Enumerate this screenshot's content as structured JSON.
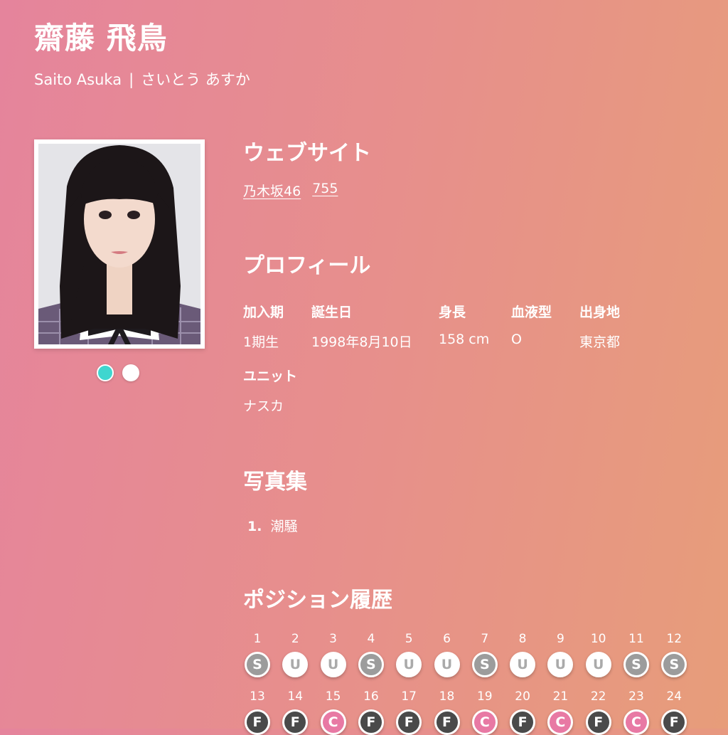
{
  "member": {
    "name": "齋藤 飛鳥",
    "romaji": "Saito Asuka",
    "separator": "|",
    "kana": "さいとう あすか"
  },
  "photo_pager": {
    "count": 2,
    "active_index": 0,
    "active_color": "#3fd6cf"
  },
  "website": {
    "title": "ウェブサイト",
    "links": [
      "乃木坂46",
      "755"
    ]
  },
  "profile": {
    "title": "プロフィール",
    "fields": [
      {
        "label": "加入期",
        "value": "1期生"
      },
      {
        "label": "誕生日",
        "value": "1998年8月10日"
      },
      {
        "label": "身長",
        "value": "158 cm"
      },
      {
        "label": "血液型",
        "value": "O"
      },
      {
        "label": "出身地",
        "value": "東京都"
      },
      {
        "label": "ユニット",
        "value": "ナスカ"
      }
    ]
  },
  "photobooks": {
    "title": "写真集",
    "items": [
      {
        "number": "1.",
        "title": "潮騒"
      }
    ]
  },
  "positions": {
    "title": "ポジション履歴",
    "colors": {
      "S": "#9c9c9c",
      "U": "#ffffff",
      "F": "#4a4a4a",
      "C": "#e879a4"
    },
    "items": [
      {
        "n": "1",
        "p": "S"
      },
      {
        "n": "2",
        "p": "U"
      },
      {
        "n": "3",
        "p": "U"
      },
      {
        "n": "4",
        "p": "S"
      },
      {
        "n": "5",
        "p": "U"
      },
      {
        "n": "6",
        "p": "U"
      },
      {
        "n": "7",
        "p": "S"
      },
      {
        "n": "8",
        "p": "U"
      },
      {
        "n": "9",
        "p": "U"
      },
      {
        "n": "10",
        "p": "U"
      },
      {
        "n": "11",
        "p": "S"
      },
      {
        "n": "12",
        "p": "S"
      },
      {
        "n": "13",
        "p": "F"
      },
      {
        "n": "14",
        "p": "F"
      },
      {
        "n": "15",
        "p": "C"
      },
      {
        "n": "16",
        "p": "F"
      },
      {
        "n": "17",
        "p": "F"
      },
      {
        "n": "18",
        "p": "F"
      },
      {
        "n": "19",
        "p": "C"
      },
      {
        "n": "20",
        "p": "F"
      },
      {
        "n": "21",
        "p": "C"
      },
      {
        "n": "22",
        "p": "F"
      },
      {
        "n": "23",
        "p": "C"
      },
      {
        "n": "24",
        "p": "F"
      }
    ]
  }
}
